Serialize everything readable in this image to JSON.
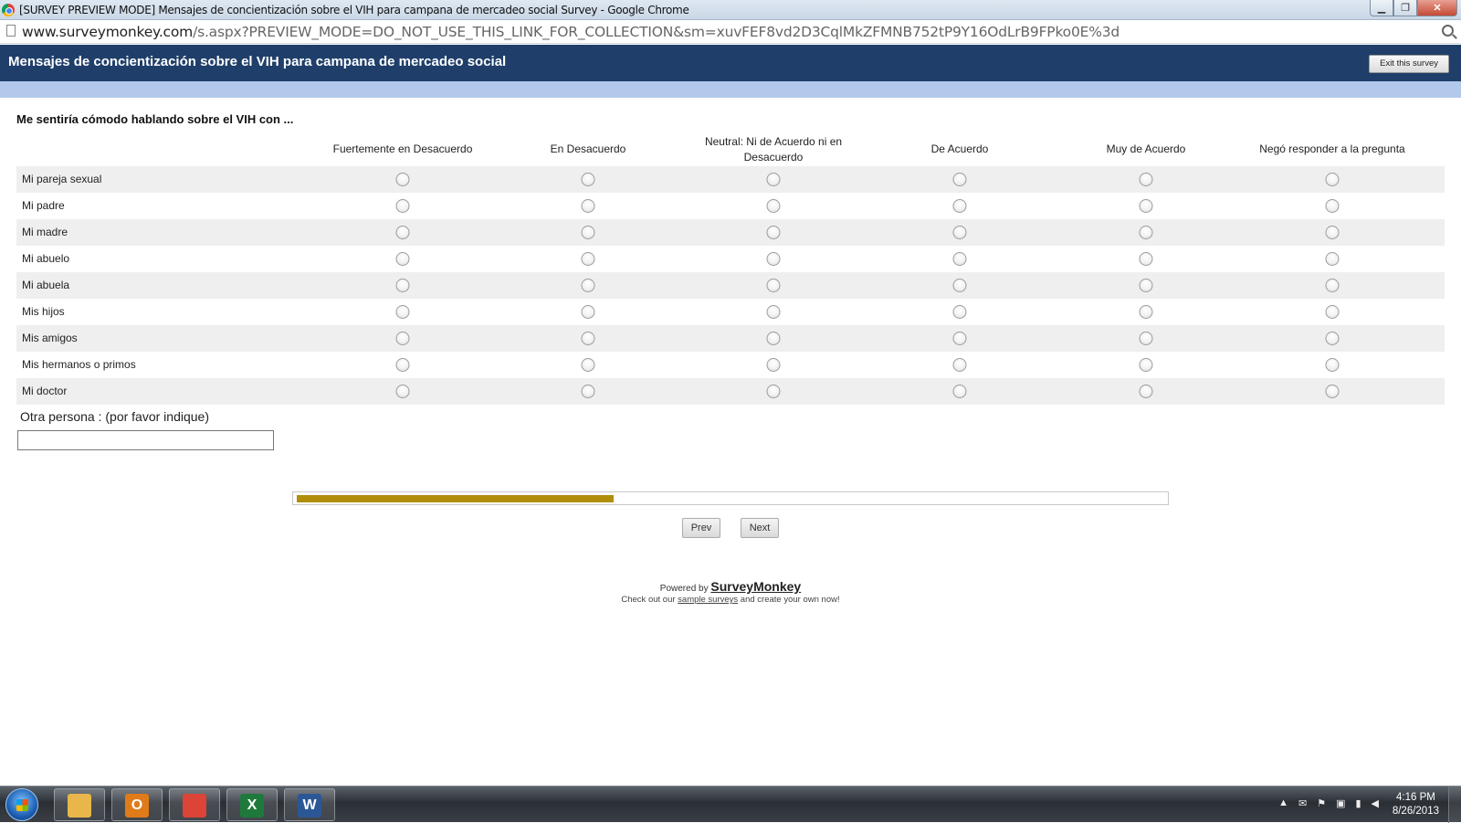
{
  "window": {
    "title": "[SURVEY PREVIEW MODE] Mensajes de concientización sobre el VIH para campana de mercadeo social Survey - Google Chrome",
    "minimize": "▁",
    "maximize": "❐",
    "close": "✕"
  },
  "address": {
    "host": "www.surveymonkey.com",
    "path": "/s.aspx?PREVIEW_MODE=DO_NOT_USE_THIS_LINK_FOR_COLLECTION&sm=xuvFEF8vd2D3CqlMkZFMNB752tP9Y16OdLrB9FPko0E%3d"
  },
  "survey": {
    "title": "Mensajes de concientización sobre el VIH para campana de mercadeo social",
    "exit_label": "Exit this survey"
  },
  "question": {
    "text": "Me sentiría cómodo hablando sobre el VIH con ...",
    "columns": [
      "Fuertemente en Desacuerdo",
      "En Desacuerdo",
      "Neutral: Ni de Acuerdo ni en Desacuerdo",
      "De Acuerdo",
      "Muy de Acuerdo",
      "Negó responder a la pregunta"
    ],
    "rows": [
      "Mi pareja sexual",
      "Mi padre",
      "Mi madre",
      "Mi abuelo",
      "Mi abuela",
      "Mis hijos",
      "Mis amigos",
      "Mis hermanos o primos",
      "Mi doctor"
    ],
    "other_label": "Otra persona : (por favor indique)",
    "other_value": ""
  },
  "progress": {
    "fraction": 0.365
  },
  "nav": {
    "prev": "Prev",
    "next": "Next"
  },
  "footer": {
    "powered_prefix": "Powered by ",
    "brand": "SurveyMonkey",
    "checkout_prefix": "Check out our ",
    "checkout_link": "sample surveys",
    "checkout_suffix": " and create your own now!"
  },
  "taskbar": {
    "apps": [
      {
        "name": "explorer-icon",
        "glyph": "",
        "color": "#e8b64a"
      },
      {
        "name": "outlook-icon",
        "glyph": "O",
        "color": "#e07b1a"
      },
      {
        "name": "chrome-icon",
        "glyph": "",
        "color": "#db4437"
      },
      {
        "name": "excel-icon",
        "glyph": "X",
        "color": "#1e7a3c"
      },
      {
        "name": "word-icon",
        "glyph": "W",
        "color": "#2b5797"
      }
    ],
    "time": "4:16 PM",
    "date": "8/26/2013"
  }
}
